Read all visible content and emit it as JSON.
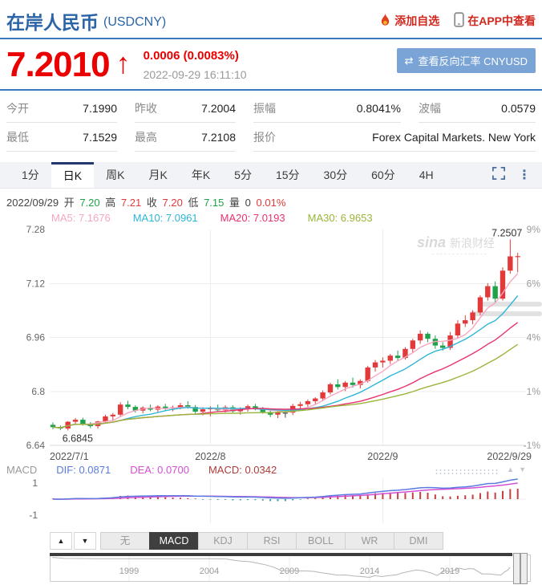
{
  "header": {
    "title": "在岸人民币",
    "symbol": "(USDCNY)",
    "add_watchlist": "添加自选",
    "view_in_app": "在APP中查看"
  },
  "quote": {
    "price": "7.2010",
    "arrow_icon": "↑",
    "change": "0.0006 (0.0083%)",
    "timestamp": "2022-09-29 16:11:10",
    "reverse_icon": "⇄",
    "reverse_label": "查看反向汇率 CNYUSD"
  },
  "stats": {
    "rows": [
      [
        {
          "label": "今开",
          "value": "7.1990"
        },
        {
          "label": "昨收",
          "value": "7.2004"
        },
        {
          "label": "振幅",
          "value": "0.8041%"
        },
        {
          "label": "波幅",
          "value": "0.0579"
        }
      ],
      [
        {
          "label": "最低",
          "value": "7.1529"
        },
        {
          "label": "最高",
          "value": "7.2108"
        },
        {
          "label": "报价",
          "value": "Forex Capital Markets. New York"
        }
      ]
    ]
  },
  "period_tabs": {
    "items": [
      "1分",
      "日K",
      "周K",
      "月K",
      "年K",
      "5分",
      "15分",
      "30分",
      "60分",
      "4H"
    ],
    "active": "日K"
  },
  "toolbar_icons": {
    "more_icon": "⋮"
  },
  "ohlc_info": {
    "date": "2022/09/29",
    "open_label": "开",
    "open": "7.20",
    "high_label": "高",
    "high": "7.21",
    "close_label": "收",
    "close": "7.20",
    "low_label": "低",
    "low": "7.15",
    "vol_label": "量",
    "vol": "0",
    "pct": "0.01%",
    "colors": {
      "up": "#e23a3a",
      "down": "#1fa24a",
      "text": "#444"
    }
  },
  "ma_legend": [
    {
      "label": "MA5: 7.1676",
      "color": "#f7a6c2"
    },
    {
      "label": "MA10: 7.0961",
      "color": "#2eb6d8"
    },
    {
      "label": "MA20: 7.0193",
      "color": "#e8336e"
    },
    {
      "label": "MA30: 6.9653",
      "color": "#9ab53a"
    }
  ],
  "macd_legend": {
    "name": "MACD",
    "dif": "DIF: 0.0871",
    "dea": "DEA: 0.0700",
    "macd": "MACD: 0.0342",
    "up_icon": "▲",
    "down_icon": "▼"
  },
  "indicator_tabs": {
    "items": [
      "无",
      "MACD",
      "KDJ",
      "RSI",
      "BOLL",
      "WR",
      "DMI"
    ],
    "active": "MACD",
    "up_icon": "▲",
    "down_icon": "▼"
  },
  "watermark": {
    "logo": "sina",
    "text": "新浪财经"
  },
  "chart_data": {
    "type": "candlestick",
    "symbol": "USDCNY",
    "period": "daily",
    "ylim": [
      6.64,
      7.28
    ],
    "y_ticks": [
      "7.28",
      "7.12",
      "6.96",
      "6.8",
      "6.64"
    ],
    "right_ticks": [
      "9%",
      "6%",
      "4%",
      "1%",
      "-1%"
    ],
    "x_ticks": [
      {
        "label": "2022/7/1",
        "index": 0
      },
      {
        "label": "2022/8",
        "index": 21
      },
      {
        "label": "2022/9",
        "index": 44
      },
      {
        "label": "2022/9/29",
        "index": 62
      }
    ],
    "up_color": "#e23a3a",
    "down_color": "#1fa24a",
    "annotations": [
      {
        "text": "6.6845",
        "index": 2,
        "pos": "below-low"
      },
      {
        "text": "7.2507",
        "index": 61,
        "pos": "above-high"
      }
    ],
    "candles": [
      [
        6.701,
        6.708,
        6.688,
        6.694
      ],
      [
        6.694,
        6.699,
        6.685,
        6.69
      ],
      [
        6.69,
        6.712,
        6.6845,
        6.71
      ],
      [
        6.71,
        6.721,
        6.703,
        6.716
      ],
      [
        6.716,
        6.722,
        6.699,
        6.703
      ],
      [
        6.703,
        6.709,
        6.691,
        6.697
      ],
      [
        6.697,
        6.713,
        6.69,
        6.711
      ],
      [
        6.711,
        6.731,
        6.706,
        6.726
      ],
      [
        6.726,
        6.736,
        6.712,
        6.731
      ],
      [
        6.731,
        6.768,
        6.726,
        6.761
      ],
      [
        6.761,
        6.772,
        6.747,
        6.754
      ],
      [
        6.754,
        6.759,
        6.737,
        6.743
      ],
      [
        6.743,
        6.756,
        6.735,
        6.752
      ],
      [
        6.752,
        6.761,
        6.741,
        6.746
      ],
      [
        6.746,
        6.759,
        6.739,
        6.755
      ],
      [
        6.755,
        6.763,
        6.744,
        6.749
      ],
      [
        6.749,
        6.758,
        6.741,
        6.753
      ],
      [
        6.753,
        6.766,
        6.747,
        6.759
      ],
      [
        6.759,
        6.771,
        6.749,
        6.754
      ],
      [
        6.754,
        6.76,
        6.734,
        6.74
      ],
      [
        6.74,
        6.753,
        6.729,
        6.747
      ],
      [
        6.747,
        6.756,
        6.726,
        6.751
      ],
      [
        6.751,
        6.761,
        6.739,
        6.744
      ],
      [
        6.744,
        6.759,
        6.737,
        6.753
      ],
      [
        6.753,
        6.759,
        6.737,
        6.741
      ],
      [
        6.741,
        6.753,
        6.731,
        6.749
      ],
      [
        6.749,
        6.761,
        6.74,
        6.756
      ],
      [
        6.756,
        6.763,
        6.744,
        6.749
      ],
      [
        6.749,
        6.754,
        6.734,
        6.739
      ],
      [
        6.739,
        6.749,
        6.724,
        6.731
      ],
      [
        6.731,
        6.742,
        6.721,
        6.738
      ],
      [
        6.737,
        6.745,
        6.722,
        6.737
      ],
      [
        6.737,
        6.763,
        6.73,
        6.757
      ],
      [
        6.757,
        6.769,
        6.749,
        6.762
      ],
      [
        6.762,
        6.776,
        6.753,
        6.771
      ],
      [
        6.771,
        6.783,
        6.763,
        6.779
      ],
      [
        6.779,
        6.803,
        6.771,
        6.797
      ],
      [
        6.797,
        6.826,
        6.791,
        6.821
      ],
      [
        6.821,
        6.836,
        6.806,
        6.813
      ],
      [
        6.813,
        6.831,
        6.801,
        6.826
      ],
      [
        6.826,
        6.841,
        6.811,
        6.819
      ],
      [
        6.819,
        6.836,
        6.809,
        6.831
      ],
      [
        6.831,
        6.876,
        6.826,
        6.871
      ],
      [
        6.871,
        6.893,
        6.859,
        6.886
      ],
      [
        6.886,
        6.901,
        6.871,
        6.891
      ],
      [
        6.891,
        6.911,
        6.881,
        6.906
      ],
      [
        6.906,
        6.921,
        6.891,
        6.899
      ],
      [
        6.899,
        6.931,
        6.894,
        6.926
      ],
      [
        6.926,
        6.956,
        6.916,
        6.951
      ],
      [
        6.951,
        6.981,
        6.941,
        6.971
      ],
      [
        6.971,
        6.976,
        6.946,
        6.956
      ],
      [
        6.956,
        6.966,
        6.926,
        6.936
      ],
      [
        6.936,
        6.946,
        6.921,
        6.929
      ],
      [
        6.929,
        6.976,
        6.923,
        6.966
      ],
      [
        6.966,
        7.011,
        6.959,
        7.001
      ],
      [
        7.001,
        7.026,
        6.991,
        7.011
      ],
      [
        7.011,
        7.041,
        6.999,
        7.034
      ],
      [
        7.034,
        7.085,
        7.026,
        7.079
      ],
      [
        7.079,
        7.121,
        7.069,
        7.112
      ],
      [
        7.112,
        7.126,
        7.064,
        7.075
      ],
      [
        7.075,
        7.168,
        7.069,
        7.158
      ],
      [
        7.158,
        7.2507,
        7.149,
        7.2004
      ],
      [
        7.199,
        7.2108,
        7.1529,
        7.201
      ]
    ],
    "ma_windows": [
      {
        "name": "MA5",
        "window": 5,
        "color": "#f7a6c2"
      },
      {
        "name": "MA10",
        "window": 10,
        "color": "#2eb6d8"
      },
      {
        "name": "MA20",
        "window": 20,
        "color": "#e8336e"
      },
      {
        "name": "MA30",
        "window": 30,
        "color": "#9ab53a"
      }
    ],
    "macd": {
      "y_ticks": [
        "1",
        "-1"
      ],
      "dif_color": "#5b7be0",
      "dea_color": "#d44fd4",
      "pos_color": "#c64040",
      "neg_color": "#3aa0ae",
      "last": {
        "dif": 0.0871,
        "dea": 0.07,
        "hist": 0.0342
      }
    },
    "navigator": {
      "type": "line",
      "year_ticks": [
        1999,
        2004,
        2009,
        2014,
        2019
      ],
      "points": [
        [
          1994.2,
          8.44
        ],
        [
          1995,
          8.32
        ],
        [
          1996,
          8.31
        ],
        [
          1997,
          8.29
        ],
        [
          1998,
          8.28
        ],
        [
          1999,
          8.28
        ],
        [
          2000,
          8.28
        ],
        [
          2001,
          8.28
        ],
        [
          2002,
          8.28
        ],
        [
          2003,
          8.28
        ],
        [
          2004,
          8.28
        ],
        [
          2005,
          8.27
        ],
        [
          2005.6,
          8.08
        ],
        [
          2006,
          8.0
        ],
        [
          2006.5,
          7.93
        ],
        [
          2007,
          7.76
        ],
        [
          2007.5,
          7.56
        ],
        [
          2008,
          7.28
        ],
        [
          2008.5,
          6.86
        ],
        [
          2009,
          6.83
        ],
        [
          2009.5,
          6.83
        ],
        [
          2010,
          6.82
        ],
        [
          2010.5,
          6.77
        ],
        [
          2011,
          6.6
        ],
        [
          2011.5,
          6.47
        ],
        [
          2012,
          6.31
        ],
        [
          2012.5,
          6.34
        ],
        [
          2013,
          6.22
        ],
        [
          2013.5,
          6.14
        ],
        [
          2014,
          6.05
        ],
        [
          2014.3,
          6.25
        ],
        [
          2014.8,
          6.14
        ],
        [
          2015,
          6.21
        ],
        [
          2015.7,
          6.36
        ],
        [
          2016,
          6.57
        ],
        [
          2016.9,
          6.94
        ],
        [
          2017.3,
          6.86
        ],
        [
          2017.8,
          6.6
        ],
        [
          2018.2,
          6.28
        ],
        [
          2018.7,
          6.87
        ],
        [
          2019,
          6.7
        ],
        [
          2019.6,
          7.15
        ],
        [
          2019.9,
          7.0
        ],
        [
          2020.2,
          7.1
        ],
        [
          2020.5,
          7.07
        ],
        [
          2020.8,
          6.7
        ],
        [
          2021,
          6.46
        ],
        [
          2021.5,
          6.46
        ],
        [
          2021.9,
          6.36
        ],
        [
          2022.2,
          6.34
        ],
        [
          2022.4,
          6.68
        ],
        [
          2022.6,
          6.9
        ],
        [
          2022.75,
          7.25
        ]
      ]
    }
  }
}
